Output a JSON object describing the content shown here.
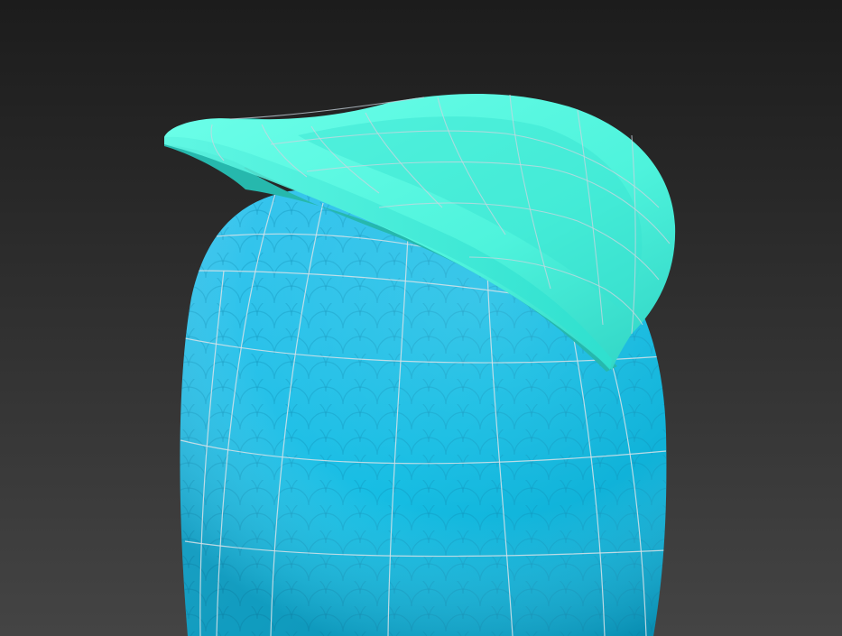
{
  "viewport": {
    "background_top": "#1c1c1c",
    "background_bottom": "#444444"
  },
  "body_object": {
    "color_light": "#3cc6ef",
    "color_mid": "#16bde3",
    "color_dark": "#0aa8cf",
    "pattern": "scale-texture",
    "wire_color": "#d8e2e8"
  },
  "hat_object": {
    "color_light": "#6dffe9",
    "color_mid": "#4ef3dc",
    "color_dark": "#2fd3c4",
    "wire_color": "#c9d6df"
  }
}
